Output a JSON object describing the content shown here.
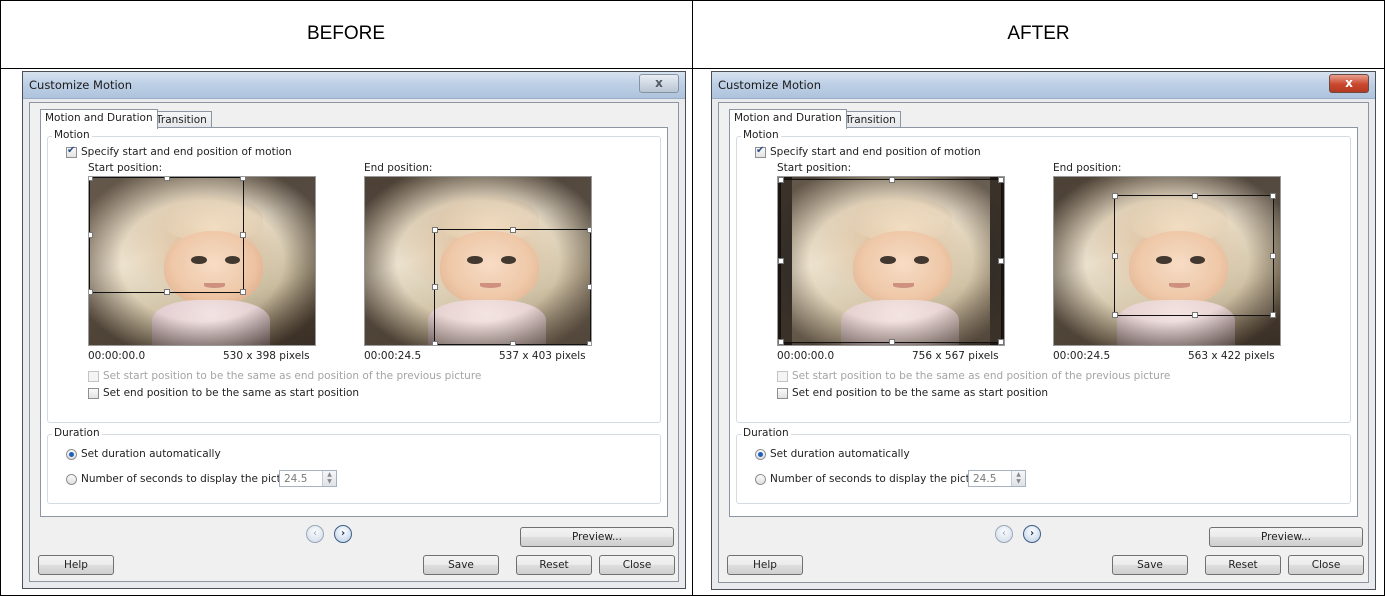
{
  "headers": {
    "before": "BEFORE",
    "after": "AFTER"
  },
  "panels": [
    {
      "key": "before",
      "title": "Customize Motion",
      "close_glyph": "x",
      "tabs": [
        "Motion and Duration",
        "Transition"
      ],
      "motion_group": "Motion",
      "specify_label": "Specify start and end position of motion",
      "start_label": "Start position:",
      "end_label": "End position:",
      "start_time": "00:00:00.0",
      "start_size": "530 x 398 pixels",
      "end_time": "00:00:24.5",
      "end_size": "537 x 403 pixels",
      "same_as_prev_label": "Set start position to be the same as end position of the previous picture",
      "end_same_label": "Set end position to be the same as start position",
      "duration_group": "Duration",
      "auto_label": "Set duration automatically",
      "seconds_label": "Number of seconds to display the picture",
      "seconds_value": "24.5",
      "preview_label": "Preview...",
      "help_label": "Help",
      "save_label": "Save",
      "reset_label": "Reset",
      "close_label": "Close"
    },
    {
      "key": "after",
      "title": "Customize Motion",
      "close_glyph": "x",
      "tabs": [
        "Motion and Duration",
        "Transition"
      ],
      "motion_group": "Motion",
      "specify_label": "Specify start and end position of motion",
      "start_label": "Start position:",
      "end_label": "End position:",
      "start_time": "00:00:00.0",
      "start_size": "756 x 567 pixels",
      "end_time": "00:00:24.5",
      "end_size": "563 x 422 pixels",
      "same_as_prev_label": "Set start position to be the same as end position of the previous picture",
      "end_same_label": "Set end position to be the same as start position",
      "duration_group": "Duration",
      "auto_label": "Set duration automatically",
      "seconds_label": "Number of seconds to display the picture",
      "seconds_value": "24.5",
      "preview_label": "Preview...",
      "help_label": "Help",
      "save_label": "Save",
      "reset_label": "Reset",
      "close_label": "Close"
    }
  ],
  "icons": {
    "prev": "chevron-left-icon",
    "next": "chevron-right-icon",
    "spin_up": "spin-up-icon",
    "spin_down": "spin-down-icon"
  }
}
